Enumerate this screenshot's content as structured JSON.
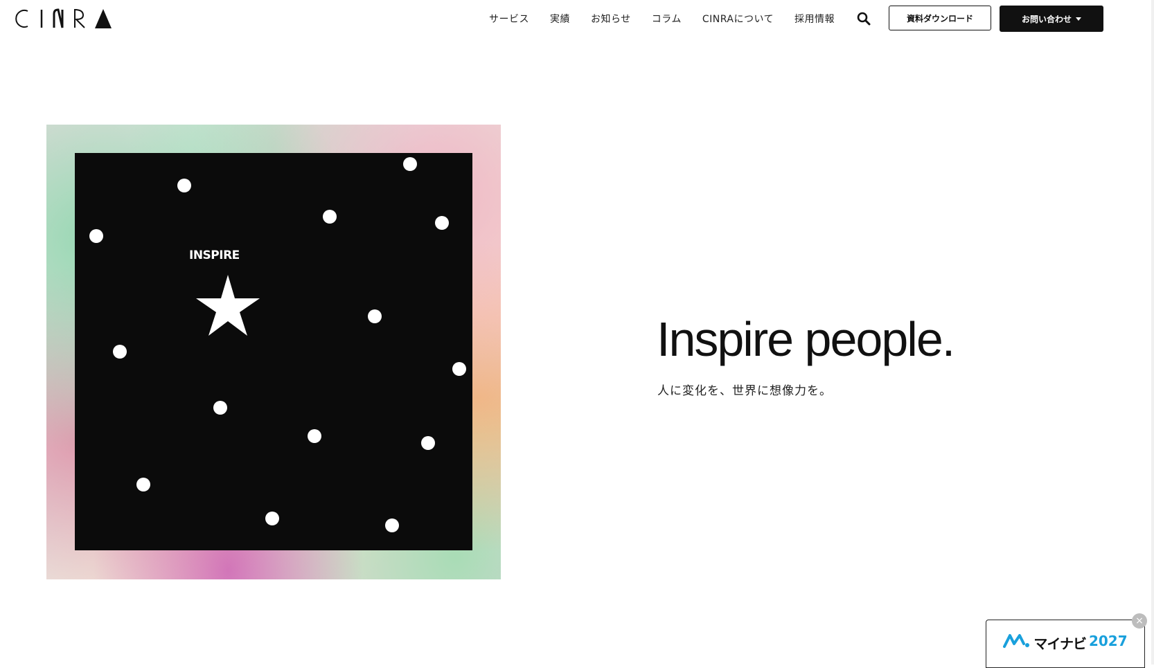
{
  "header": {
    "logo_text": "CINRA",
    "nav": [
      "サービス",
      "実績",
      "お知らせ",
      "コラム",
      "CINRAについて",
      "採用情報"
    ],
    "download_button": "資料ダウンロード",
    "contact_button": "お問い合わせ"
  },
  "hero": {
    "art_label": "INSPIRE",
    "headline": "Inspire people.",
    "subline": "人に変化を、世界に想像力を。"
  },
  "banner": {
    "brand": "マイナビ",
    "year": "2027",
    "close_label": "×"
  },
  "colors": {
    "text": "#111111",
    "mynavi_blue": "#19a0dc"
  }
}
